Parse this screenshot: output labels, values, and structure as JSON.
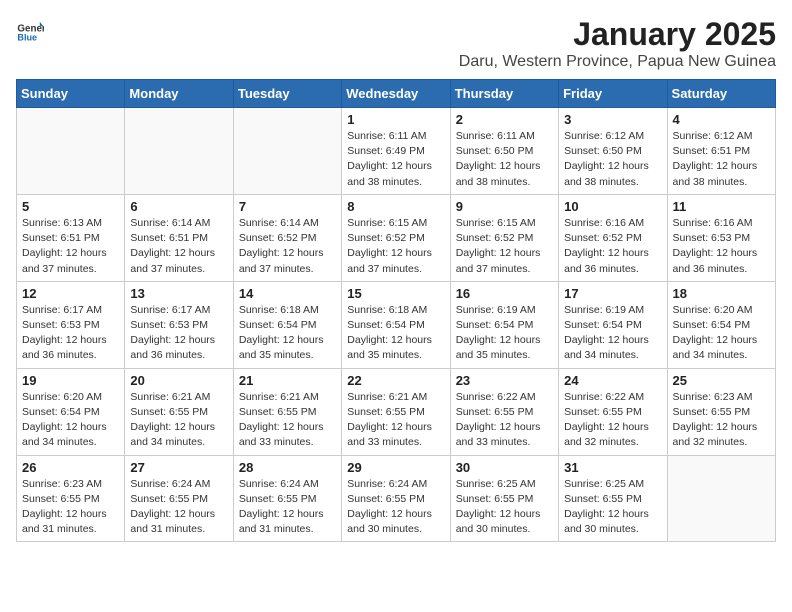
{
  "logo": {
    "general": "General",
    "blue": "Blue"
  },
  "title": "January 2025",
  "subtitle": "Daru, Western Province, Papua New Guinea",
  "weekdays": [
    "Sunday",
    "Monday",
    "Tuesday",
    "Wednesday",
    "Thursday",
    "Friday",
    "Saturday"
  ],
  "weeks": [
    [
      {
        "day": "",
        "info": ""
      },
      {
        "day": "",
        "info": ""
      },
      {
        "day": "",
        "info": ""
      },
      {
        "day": "1",
        "info": "Sunrise: 6:11 AM\nSunset: 6:49 PM\nDaylight: 12 hours and 38 minutes."
      },
      {
        "day": "2",
        "info": "Sunrise: 6:11 AM\nSunset: 6:50 PM\nDaylight: 12 hours and 38 minutes."
      },
      {
        "day": "3",
        "info": "Sunrise: 6:12 AM\nSunset: 6:50 PM\nDaylight: 12 hours and 38 minutes."
      },
      {
        "day": "4",
        "info": "Sunrise: 6:12 AM\nSunset: 6:51 PM\nDaylight: 12 hours and 38 minutes."
      }
    ],
    [
      {
        "day": "5",
        "info": "Sunrise: 6:13 AM\nSunset: 6:51 PM\nDaylight: 12 hours and 37 minutes."
      },
      {
        "day": "6",
        "info": "Sunrise: 6:14 AM\nSunset: 6:51 PM\nDaylight: 12 hours and 37 minutes."
      },
      {
        "day": "7",
        "info": "Sunrise: 6:14 AM\nSunset: 6:52 PM\nDaylight: 12 hours and 37 minutes."
      },
      {
        "day": "8",
        "info": "Sunrise: 6:15 AM\nSunset: 6:52 PM\nDaylight: 12 hours and 37 minutes."
      },
      {
        "day": "9",
        "info": "Sunrise: 6:15 AM\nSunset: 6:52 PM\nDaylight: 12 hours and 37 minutes."
      },
      {
        "day": "10",
        "info": "Sunrise: 6:16 AM\nSunset: 6:52 PM\nDaylight: 12 hours and 36 minutes."
      },
      {
        "day": "11",
        "info": "Sunrise: 6:16 AM\nSunset: 6:53 PM\nDaylight: 12 hours and 36 minutes."
      }
    ],
    [
      {
        "day": "12",
        "info": "Sunrise: 6:17 AM\nSunset: 6:53 PM\nDaylight: 12 hours and 36 minutes."
      },
      {
        "day": "13",
        "info": "Sunrise: 6:17 AM\nSunset: 6:53 PM\nDaylight: 12 hours and 36 minutes."
      },
      {
        "day": "14",
        "info": "Sunrise: 6:18 AM\nSunset: 6:54 PM\nDaylight: 12 hours and 35 minutes."
      },
      {
        "day": "15",
        "info": "Sunrise: 6:18 AM\nSunset: 6:54 PM\nDaylight: 12 hours and 35 minutes."
      },
      {
        "day": "16",
        "info": "Sunrise: 6:19 AM\nSunset: 6:54 PM\nDaylight: 12 hours and 35 minutes."
      },
      {
        "day": "17",
        "info": "Sunrise: 6:19 AM\nSunset: 6:54 PM\nDaylight: 12 hours and 34 minutes."
      },
      {
        "day": "18",
        "info": "Sunrise: 6:20 AM\nSunset: 6:54 PM\nDaylight: 12 hours and 34 minutes."
      }
    ],
    [
      {
        "day": "19",
        "info": "Sunrise: 6:20 AM\nSunset: 6:54 PM\nDaylight: 12 hours and 34 minutes."
      },
      {
        "day": "20",
        "info": "Sunrise: 6:21 AM\nSunset: 6:55 PM\nDaylight: 12 hours and 34 minutes."
      },
      {
        "day": "21",
        "info": "Sunrise: 6:21 AM\nSunset: 6:55 PM\nDaylight: 12 hours and 33 minutes."
      },
      {
        "day": "22",
        "info": "Sunrise: 6:21 AM\nSunset: 6:55 PM\nDaylight: 12 hours and 33 minutes."
      },
      {
        "day": "23",
        "info": "Sunrise: 6:22 AM\nSunset: 6:55 PM\nDaylight: 12 hours and 33 minutes."
      },
      {
        "day": "24",
        "info": "Sunrise: 6:22 AM\nSunset: 6:55 PM\nDaylight: 12 hours and 32 minutes."
      },
      {
        "day": "25",
        "info": "Sunrise: 6:23 AM\nSunset: 6:55 PM\nDaylight: 12 hours and 32 minutes."
      }
    ],
    [
      {
        "day": "26",
        "info": "Sunrise: 6:23 AM\nSunset: 6:55 PM\nDaylight: 12 hours and 31 minutes."
      },
      {
        "day": "27",
        "info": "Sunrise: 6:24 AM\nSunset: 6:55 PM\nDaylight: 12 hours and 31 minutes."
      },
      {
        "day": "28",
        "info": "Sunrise: 6:24 AM\nSunset: 6:55 PM\nDaylight: 12 hours and 31 minutes."
      },
      {
        "day": "29",
        "info": "Sunrise: 6:24 AM\nSunset: 6:55 PM\nDaylight: 12 hours and 30 minutes."
      },
      {
        "day": "30",
        "info": "Sunrise: 6:25 AM\nSunset: 6:55 PM\nDaylight: 12 hours and 30 minutes."
      },
      {
        "day": "31",
        "info": "Sunrise: 6:25 AM\nSunset: 6:55 PM\nDaylight: 12 hours and 30 minutes."
      },
      {
        "day": "",
        "info": ""
      }
    ]
  ]
}
